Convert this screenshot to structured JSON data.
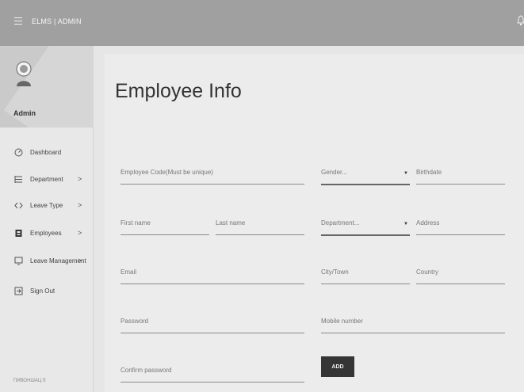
{
  "app": {
    "brand": "ELMS | ADMIN"
  },
  "profile": {
    "name": "Admin"
  },
  "sidebar": {
    "items": [
      {
        "label": "Dashboard",
        "chevron": ""
      },
      {
        "label": "Department",
        "chevron": ">"
      },
      {
        "label": "Leave Type",
        "chevron": ">"
      },
      {
        "label": "Employees",
        "chevron": ">"
      },
      {
        "label": "Leave Management",
        "chevron": ">"
      },
      {
        "label": "Sign Out",
        "chevron": ""
      }
    ],
    "footer": "ПИВОНШАЦ б"
  },
  "page": {
    "title": "Employee Info"
  },
  "form": {
    "employee_code": "Employee Code(Must be unique)",
    "first_name": "First name",
    "last_name": "Last name",
    "email": "Email",
    "password": "Password",
    "confirm_password": "Confirm password",
    "gender": "Gender...",
    "birthdate": "Birthdate",
    "department": "Department...",
    "address": "Address",
    "city": "City/Town",
    "country": "Country",
    "mobile": "Mobile number",
    "add_button": "ADD"
  }
}
